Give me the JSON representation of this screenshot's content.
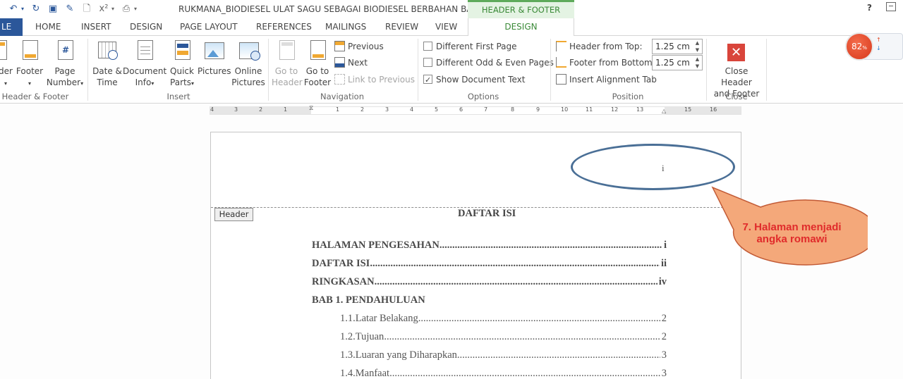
{
  "titlebar": {
    "document_title": "RUKMANA_BIODIESEL ULAT SAGU SEBAGAI BIODIESEL BERBAHAN BAK...",
    "context_tab": "HEADER & FOOTER TOOLS",
    "help": "?"
  },
  "tabs": [
    "LE",
    "HOME",
    "INSERT",
    "DESIGN",
    "PAGE LAYOUT",
    "REFERENCES",
    "MAILINGS",
    "REVIEW",
    "VIEW",
    "DESIGN"
  ],
  "ribbon": {
    "header_footer": {
      "header_label": "der",
      "footer_label": "Footer",
      "page_number_1": "Page",
      "page_number_2": "Number",
      "group": "Header & Footer"
    },
    "insert": {
      "date_time_1": "Date &",
      "date_time_2": "Time",
      "doc_info_1": "Document",
      "doc_info_2": "Info",
      "quick_parts_1": "Quick",
      "quick_parts_2": "Parts",
      "pictures": "Pictures",
      "online_pictures_1": "Online",
      "online_pictures_2": "Pictures",
      "group": "Insert"
    },
    "navigation": {
      "go_to_header_1": "Go to",
      "go_to_header_2": "Header",
      "go_to_footer_1": "Go to",
      "go_to_footer_2": "Footer",
      "previous": "Previous",
      "next": "Next",
      "link_to_previous": "Link to Previous",
      "group": "Navigation"
    },
    "options": {
      "different_first_page": "Different First Page",
      "different_odd_even": "Different Odd & Even Pages",
      "show_document_text": "Show Document Text",
      "different_first_page_checked": false,
      "different_odd_even_checked": false,
      "show_document_text_checked": true,
      "group": "Options"
    },
    "position": {
      "header_from_top": "Header from Top:",
      "header_from_top_value": "1.25 cm",
      "footer_from_bottom": "Footer from Bottom:",
      "footer_from_bottom_value": "1.25 cm",
      "insert_alignment_tab": "Insert Alignment Tab",
      "group": "Position"
    },
    "close": {
      "label_1": "Close Header",
      "label_2": "and Footer",
      "group": "Close"
    }
  },
  "ruler": {
    "numbers": [
      "4",
      "3",
      "2",
      "1",
      "1",
      "2",
      "3",
      "4",
      "5",
      "6",
      "7",
      "8",
      "9",
      "10",
      "11",
      "12",
      "13",
      "15",
      "16"
    ]
  },
  "document": {
    "header_tag": "Header",
    "page_number_in_header": "i",
    "toc_title": "DAFTAR ISI",
    "toc": [
      {
        "label": "HALAMAN PENGESAHAN",
        "page": "i",
        "bold": true
      },
      {
        "label": "DAFTAR ISI",
        "page": "ii",
        "bold": true
      },
      {
        "label": "RINGKASAN",
        "page": "iv",
        "bold": true
      },
      {
        "label": "BAB 1. PENDAHULUAN",
        "page": "",
        "bold": true
      },
      {
        "label": "1.1.Latar Belakang",
        "page": "2",
        "bold": false
      },
      {
        "label": "1.2.Tujuan",
        "page": "2",
        "bold": false
      },
      {
        "label": "1.3.Luaran yang Diharapkan",
        "page": "3",
        "bold": false
      },
      {
        "label": "1.4.Manfaat",
        "page": "3",
        "bold": false
      }
    ]
  },
  "annotation": {
    "callout": "7. Halaman menjadi angka romawi",
    "ellipse_color": "#4a6f96",
    "callout_fill": "#f4a87a",
    "callout_text_color": "#e02b2b"
  },
  "widget": {
    "percent": "82",
    "percent_sign": "%"
  },
  "colors": {
    "file_tab": "#2b579a",
    "context_green": "#3b8a38"
  }
}
